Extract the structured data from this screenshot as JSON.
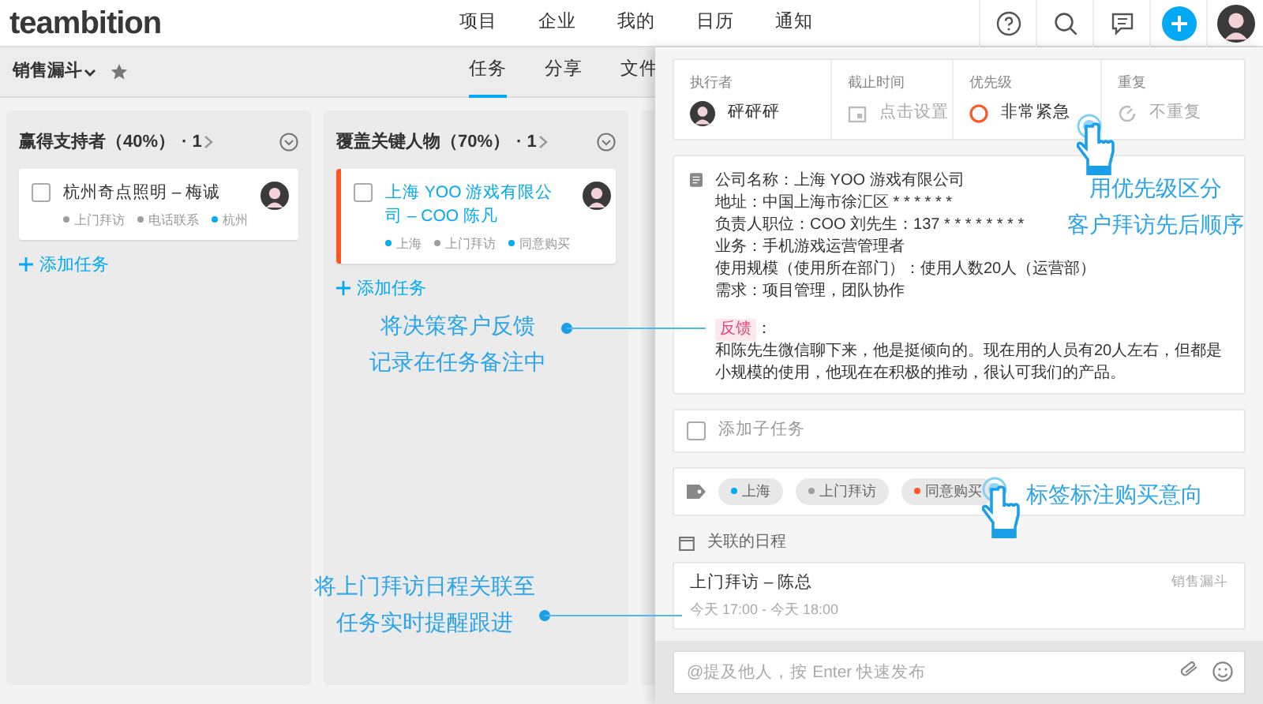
{
  "header": {
    "logo": "teambition",
    "nav": [
      {
        "label": "项目"
      },
      {
        "label": "企业"
      },
      {
        "label": "我的"
      },
      {
        "label": "日历"
      },
      {
        "label": "通知"
      }
    ]
  },
  "project_bar": {
    "title": "销售漏斗",
    "tabs": [
      {
        "label": "任务",
        "selected": true
      },
      {
        "label": "分享",
        "selected": false
      },
      {
        "label": "文件",
        "selected": false
      }
    ]
  },
  "columns": [
    {
      "title": "赢得支持者（40%）",
      "count": "· 1",
      "add_label": "添加任务",
      "tasks": [
        {
          "title": "杭州奇点照明 – 梅诚",
          "checked": false,
          "selected": false,
          "urgent": false,
          "tags": [
            {
              "label": "上门拜访",
              "color": "#9e9e9e"
            },
            {
              "label": "电话联系",
              "color": "#9e9e9e"
            },
            {
              "label": "杭州",
              "color": "#03a9f4"
            }
          ]
        }
      ]
    },
    {
      "title": "覆盖关键人物（70%）",
      "count": "· 1",
      "add_label": "添加任务",
      "tasks": [
        {
          "title": "上海 YOO 游戏有限公司 – COO 陈凡",
          "checked": false,
          "selected": true,
          "urgent": true,
          "tags": [
            {
              "label": "上海",
              "color": "#03a9f4"
            },
            {
              "label": "上门拜访",
              "color": "#9e9e9e"
            },
            {
              "label": "同意购买",
              "color": "#03a9f4"
            }
          ]
        }
      ]
    }
  ],
  "detail": {
    "fields": [
      {
        "kind": "assignee",
        "label": "执行者",
        "value": "砰砰砰"
      },
      {
        "kind": "date",
        "label": "截止时间",
        "placeholder": "点击设置"
      },
      {
        "kind": "priority",
        "label": "优先级",
        "value": "非常紧急"
      },
      {
        "kind": "repeat",
        "label": "重复",
        "placeholder": "不重复"
      }
    ],
    "note": {
      "lines": [
        "公司名称：上海 YOO 游戏有限公司",
        "地址：中国上海市徐汇区 * * * * * *",
        "负责人职位：COO 刘先生：137 * * * * * * * *",
        "业务：手机游戏运营管理者",
        "使用规模（使用所在部门）：使用人数20人（运营部）",
        "需求：项目管理，团队协作"
      ],
      "feedback_tag": "反馈",
      "feedback_suffix": "：",
      "feedback_text": "和陈先生微信聊下来，他是挺倾向的。现在用的人员有20人左右，但都是小规模的使用，他现在在积极的推动，很认可我们的产品。"
    },
    "subtask": {
      "label": "添加子任务",
      "checked": false
    },
    "tags": [
      {
        "label": "上海",
        "color": "#03a9f4"
      },
      {
        "label": "上门拜访",
        "color": "#9e9e9e"
      },
      {
        "label": "同意购买",
        "color": "#ff5722"
      }
    ],
    "schedule": {
      "heading": "关联的日程",
      "events": [
        {
          "title": "上门拜访 – 陈总",
          "project": "销售漏斗",
          "time": "今天 17:00 - 今天 18:00"
        }
      ]
    },
    "comment": {
      "placeholder": "@提及他人，按 Enter 快速发布"
    }
  },
  "annotations": [
    {
      "kind": "leader",
      "lines": [
        "将决策客户反馈",
        "记录在任务备注中"
      ]
    },
    {
      "kind": "leader",
      "lines": [
        "将上门拜访日程关联至",
        "任务实时提醒跟进"
      ]
    },
    {
      "kind": "hand",
      "lines": [
        "用优先级区分",
        "客户拜访先后顺序"
      ]
    },
    {
      "kind": "hand",
      "lines": [
        "标签标注购买意向"
      ]
    }
  ]
}
